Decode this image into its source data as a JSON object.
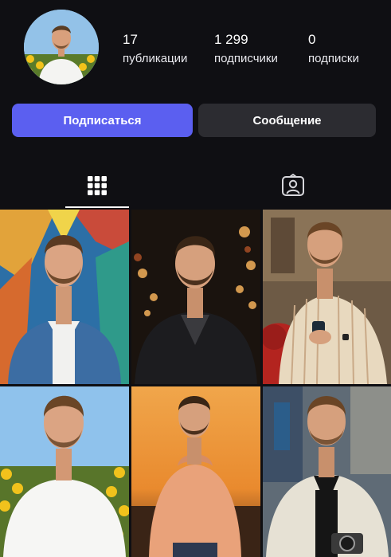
{
  "profile": {
    "avatar_icon": "profile-photo",
    "stats": [
      {
        "value": "17",
        "label": "публикации"
      },
      {
        "value": "1 299",
        "label": "подписчики"
      },
      {
        "value": "0",
        "label": "подписки"
      }
    ]
  },
  "actions": {
    "subscribe_label": "Подписаться",
    "message_label": "Сообщение"
  },
  "tabs": [
    {
      "icon": "grid-icon",
      "active": true
    },
    {
      "icon": "tagged-person-icon",
      "active": false
    }
  ],
  "posts": [
    {
      "scene": "colorful-wall-denim-jacket"
    },
    {
      "scene": "night-bokeh-bomber-jacket"
    },
    {
      "scene": "striped-shirt-scooter-phone"
    },
    {
      "scene": "sunflower-field-white-tee"
    },
    {
      "scene": "sunset-peach-hoodie"
    },
    {
      "scene": "street-jacket-camera"
    }
  ],
  "colors": {
    "background": "#0f0f13",
    "accent": "#5b5ff0",
    "secondary_button": "#2c2c31"
  }
}
